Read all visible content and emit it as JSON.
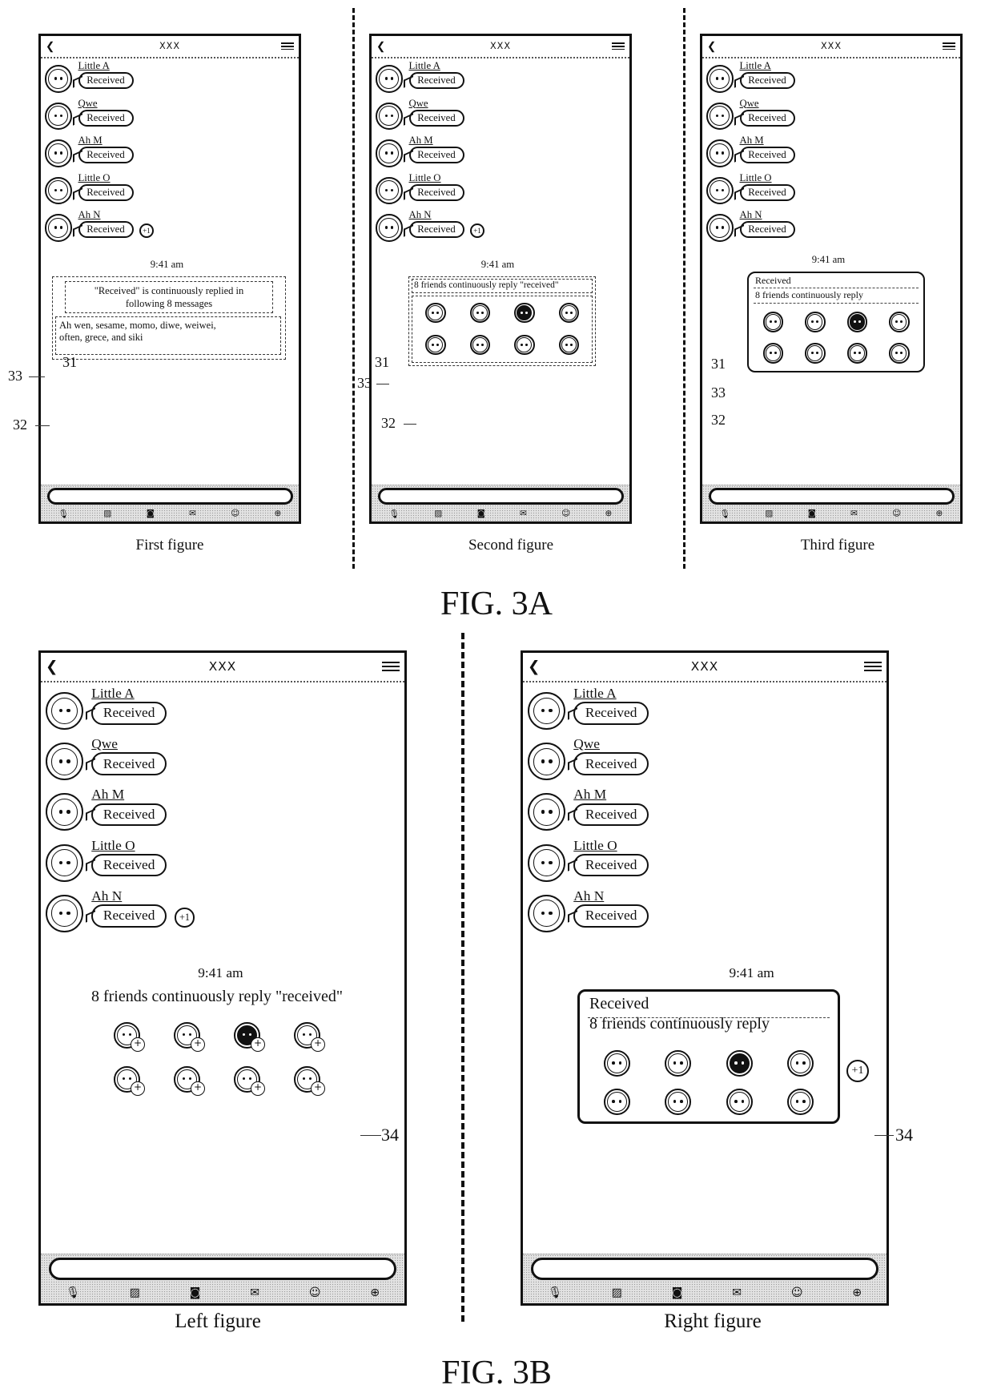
{
  "app": {
    "title": "XXX",
    "back_icon": "chevron-left-icon",
    "menu_icon": "hamburger-menu-icon"
  },
  "messages": [
    {
      "sender": "Little A",
      "text": "Received",
      "avatar": "girl-face-avatar"
    },
    {
      "sender": "Qwe",
      "text": "Received",
      "avatar": "bird-avatar"
    },
    {
      "sender": "Ah M",
      "text": "Received",
      "avatar": "boy-face-avatar"
    },
    {
      "sender": "Little O",
      "text": "Received",
      "avatar": "one-eyed-monster-avatar"
    },
    {
      "sender": "Ah N",
      "text": "Received",
      "avatar": "astronaut-avatar"
    }
  ],
  "plus_one_label": "+1",
  "timestamp": "9:41 am",
  "toolbar": {
    "icons": [
      "microphone-icon",
      "image-icon",
      "camera-icon",
      "red-envelope-icon",
      "emoji-icon",
      "plus-circle-icon"
    ]
  },
  "fig3a": {
    "label": "FIG. 3A",
    "first": {
      "caption": "First figure",
      "summary_line1": "\"Received\" is continuously replied in",
      "summary_line2": "following 8 messages",
      "names_line1": "Ah wen, sesame, momo, diwe, weiwei,",
      "names_line2": "often, grece, and siki",
      "refs": {
        "r31": "31",
        "r32": "32",
        "r33": "33"
      }
    },
    "second": {
      "caption": "Second figure",
      "summary": "8 friends continuously reply \"received\"",
      "refs": {
        "r31": "31",
        "r32": "32",
        "r33": "33"
      }
    },
    "third": {
      "caption": "Third figure",
      "content": "Received",
      "summary": "8 friends continuously reply",
      "refs": {
        "r31": "31",
        "r32": "32",
        "r33": "33"
      }
    }
  },
  "fig3b": {
    "label": "FIG. 3B",
    "left": {
      "caption": "Left figure",
      "summary": "8 friends continuously reply \"received\"",
      "add_badge": "+",
      "refs": {
        "r34": "34"
      }
    },
    "right": {
      "caption": "Right figure",
      "content": "Received",
      "summary": "8 friends continuously reply",
      "refs": {
        "r34": "34"
      }
    }
  },
  "friends": [
    {
      "avatar": "friend-avatar-1"
    },
    {
      "avatar": "friend-avatar-2"
    },
    {
      "avatar": "friend-avatar-3",
      "dark": true
    },
    {
      "avatar": "friend-avatar-4"
    },
    {
      "avatar": "friend-avatar-5"
    },
    {
      "avatar": "friend-avatar-6"
    },
    {
      "avatar": "friend-avatar-7"
    },
    {
      "avatar": "friend-avatar-8"
    }
  ]
}
